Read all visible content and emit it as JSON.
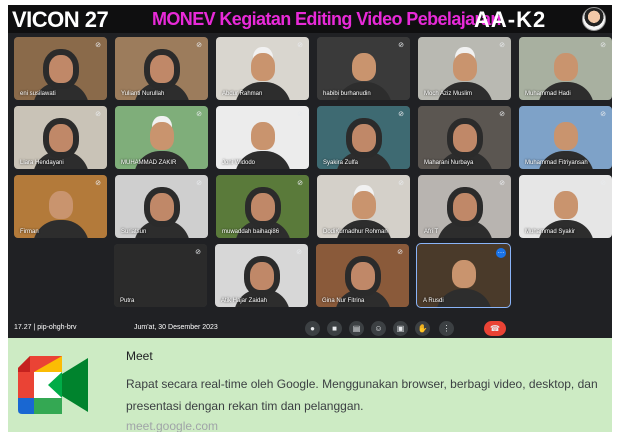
{
  "banner": {
    "vicon": "VICON 27",
    "monev": "MONEV Kegiatan Editing Video Pebelajaran",
    "code": "AA-K2"
  },
  "participants": [
    {
      "name": "eni susilawati",
      "style": "hijab",
      "bg": "#8a6a4a"
    },
    {
      "name": "Yulianti Nurullah",
      "style": "hijab",
      "bg": "#9c7c5c"
    },
    {
      "name": "Abdur Rahman",
      "style": "cap",
      "bg": "#d9d6cf"
    },
    {
      "name": "habibi burhanudin",
      "style": "plain",
      "bg": "#3a3a3a"
    },
    {
      "name": "Moch Aziz Muslim",
      "style": "cap",
      "bg": "#b9b9b2"
    },
    {
      "name": "Muhammad Hadi",
      "style": "plain",
      "bg": "#a8b0a0"
    },
    {
      "name": "Liara Hendayani",
      "style": "hijab",
      "bg": "#c9c3b7"
    },
    {
      "name": "MUHAMMAD ZAKIR",
      "style": "cap",
      "bg": "#7fae7a"
    },
    {
      "name": "Joni Widodo",
      "style": "plain",
      "bg": "#ececec"
    },
    {
      "name": "Syakira Zulfa",
      "style": "hijab",
      "bg": "#3e6a72"
    },
    {
      "name": "Maharani Nurbaya",
      "style": "hijab",
      "bg": "#5b5651"
    },
    {
      "name": "Muhammad Fitriyansah",
      "style": "plain",
      "bg": "#7ea2c8"
    },
    {
      "name": "Firman",
      "style": "plain",
      "bg": "#b37a3a"
    },
    {
      "name": "Suriatsun",
      "style": "hijab",
      "bg": "#cfcfcf"
    },
    {
      "name": "muwaddah baihaqi86",
      "style": "hijab",
      "bg": "#5a7a3a"
    },
    {
      "name": "DodiKurnadhur Rohman",
      "style": "cap",
      "bg": "#d4d0c9"
    },
    {
      "name": "Afri T",
      "style": "hijab",
      "bg": "#b8b4b0"
    },
    {
      "name": "Muhammad Syakir",
      "style": "plain",
      "bg": "#e6e6e6"
    },
    {
      "name": "Putra",
      "style": "none",
      "bg": "#2b2b2b"
    },
    {
      "name": "Atik Hajar Zaidah",
      "style": "hijab",
      "bg": "#d7d7d7"
    },
    {
      "name": "Gina Nur Fitrina",
      "style": "hijab",
      "bg": "#8a5a3a"
    },
    {
      "name": "A Rusdi",
      "style": "plain",
      "bg": "#4a3a2a"
    }
  ],
  "bar": {
    "time": "17.27",
    "meeting_code": "pip-ohgh-brv",
    "date": "Jum'at, 30 Desember 2023",
    "controls": [
      "mic-icon",
      "camera-icon",
      "captions-icon",
      "emoji-icon",
      "present-icon",
      "raise-hand-icon",
      "more-icon",
      "end-call-icon"
    ]
  },
  "card": {
    "title": "Meet",
    "description": "Rapat secara real-time oleh Google. Menggunakan browser, berbagi video, desktop, dan presentasi dengan rekan tim dan pelanggan.",
    "url": "meet.google.com"
  },
  "colors": {
    "meet_bg": "#202124",
    "title_magenta": "#e82ad8",
    "end_call": "#ea4335",
    "card_bg": "#cdebc4"
  }
}
